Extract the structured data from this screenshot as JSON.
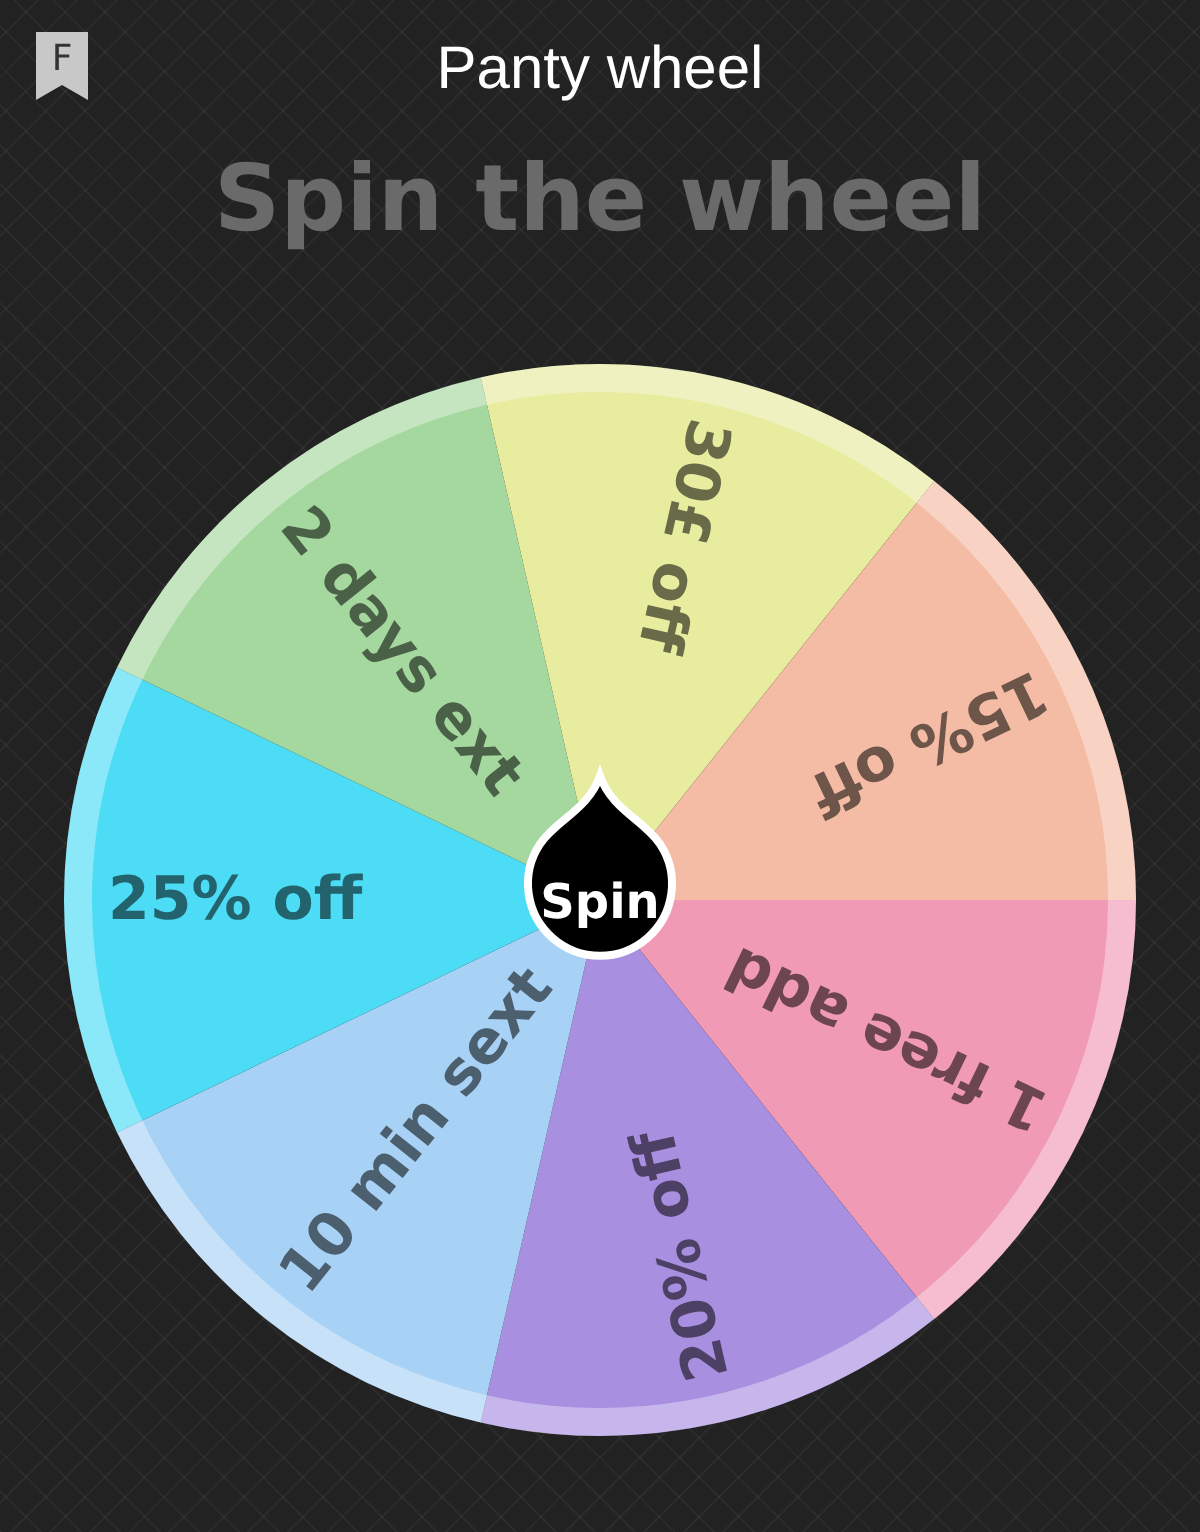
{
  "app_bar": {
    "badge": "F",
    "title": "Panty wheel"
  },
  "heading": "Spin the wheel",
  "wheel": {
    "segments": [
      {
        "label": "1 free add",
        "color": "#f09ab5"
      },
      {
        "label": "20% off",
        "color": "#a98fe0"
      },
      {
        "label": "10 min sext",
        "color": "#a8d2f5"
      },
      {
        "label": "25% off",
        "color": "#4ddcf5"
      },
      {
        "label": "2 days ext",
        "color": "#a5d89e"
      },
      {
        "label": "30£ off",
        "color": "#e7ec9f"
      },
      {
        "label": "15% off",
        "color": "#f5bca5"
      }
    ],
    "spin_button": "Spin"
  }
}
